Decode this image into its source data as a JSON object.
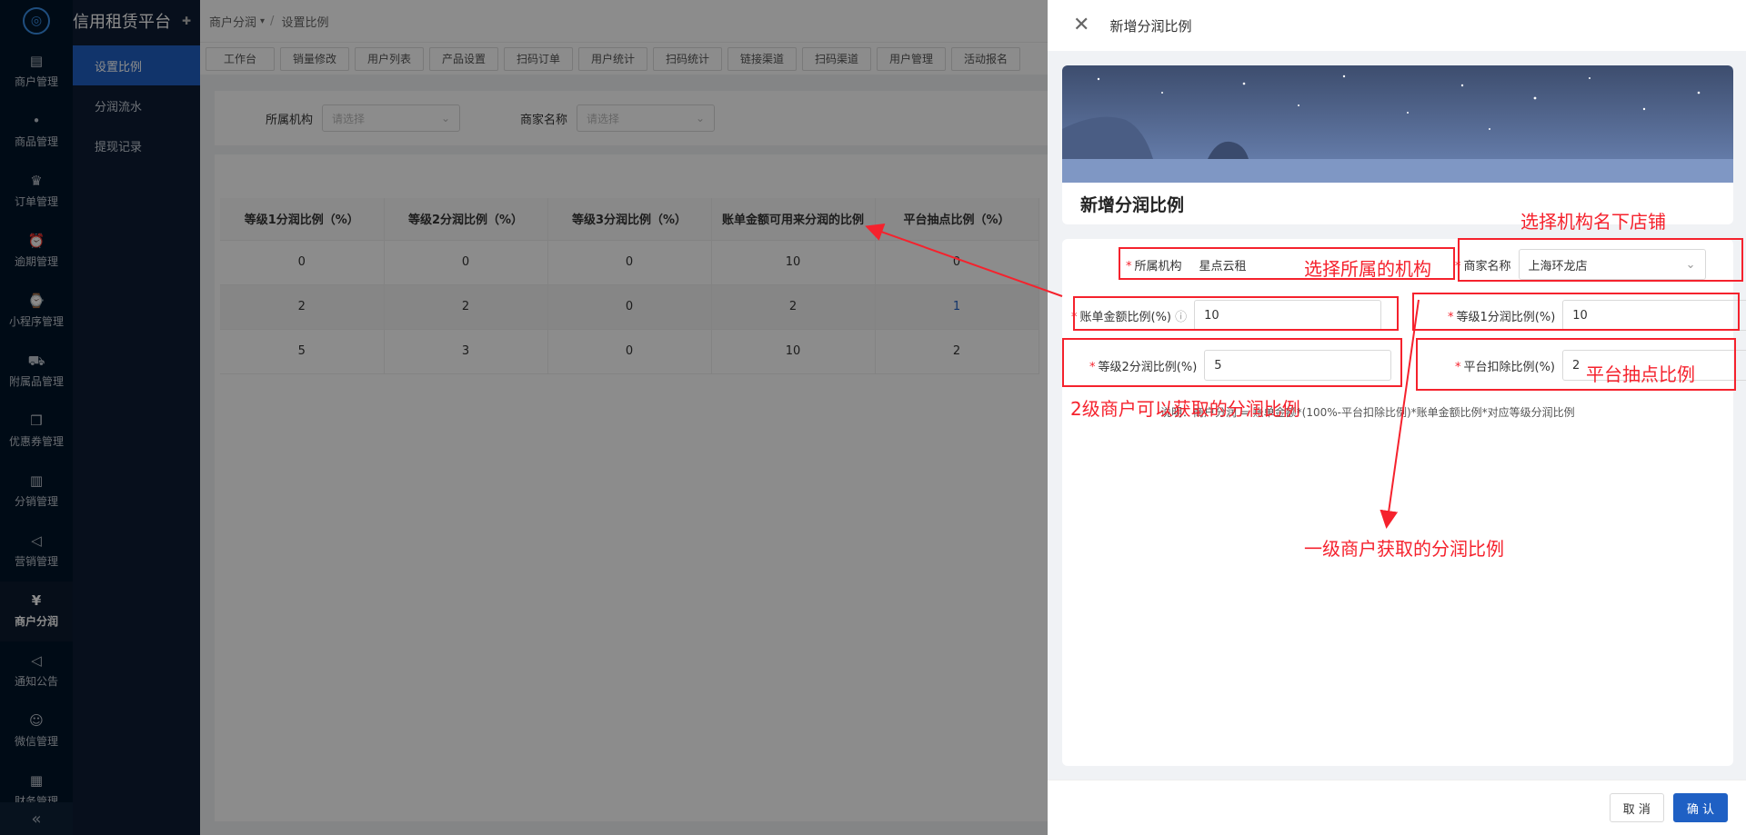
{
  "sidebar": {
    "brand": "信用租赁平台",
    "items": [
      {
        "label": "商户管理",
        "icon": "store-icon"
      },
      {
        "label": "商品管理",
        "icon": "apple-icon"
      },
      {
        "label": "订单管理",
        "icon": "trophy-icon"
      },
      {
        "label": "逾期管理",
        "icon": "alarm-icon"
      },
      {
        "label": "小程序管理",
        "icon": "watch-icon"
      },
      {
        "label": "附属品管理",
        "icon": "cart-icon"
      },
      {
        "label": "优惠券管理",
        "icon": "gift-icon"
      },
      {
        "label": "分销管理",
        "icon": "chart-icon"
      },
      {
        "label": "营销管理",
        "icon": "megaphone-icon"
      },
      {
        "label": "商户分润",
        "icon": "yen-icon",
        "active": true
      },
      {
        "label": "通知公告",
        "icon": "notice-icon"
      },
      {
        "label": "微信管理",
        "icon": "wechat-icon"
      },
      {
        "label": "财务管理",
        "icon": "finance-icon"
      }
    ],
    "collapse_glyph": "«"
  },
  "subnav": {
    "items": [
      {
        "label": "设置比例",
        "active": true
      },
      {
        "label": "分润流水"
      },
      {
        "label": "提现记录"
      }
    ]
  },
  "breadcrumb": {
    "parent": "商户分润",
    "separator": "/",
    "current": "设置比例"
  },
  "tabs": [
    "工作台",
    "销量修改",
    "用户列表",
    "产品设置",
    "扫码订单",
    "用户统计",
    "扫码统计",
    "链接渠道",
    "扫码渠道",
    "用户管理",
    "活动报名"
  ],
  "filter": {
    "org_label": "所属机构",
    "org_placeholder": "请选择",
    "merchant_label": "商家名称",
    "merchant_placeholder": "请选择"
  },
  "table": {
    "headers": [
      "等级1分润比例（%）",
      "等级2分润比例（%）",
      "等级3分润比例（%）",
      "账单金额可用来分润的比例",
      "平台抽点比例（%）"
    ],
    "rows": [
      [
        "0",
        "0",
        "0",
        "10",
        "0"
      ],
      [
        "2",
        "2",
        "0",
        "2",
        "1"
      ],
      [
        "5",
        "3",
        "0",
        "10",
        "2"
      ]
    ]
  },
  "drawer": {
    "header_title": "新增分润比例",
    "card_title": "新增分润比例",
    "fields": {
      "org_label": "所属机构",
      "org_value": "星点云租",
      "merchant_label": "商家名称",
      "merchant_value": "上海环龙店",
      "bill_ratio_label": "账单金额比例(%)",
      "bill_ratio_value": "10",
      "level1_label": "等级1分润比例(%)",
      "level1_value": "10",
      "level2_label": "等级2分润比例(%)",
      "level2_value": "5",
      "platform_label": "平台扣除比例(%)",
      "platform_value": "2"
    },
    "note": "说明：商户分润 = 账单金额*(100%-平台扣除比例)*账单金额比例*对应等级分润比例",
    "cancel_label": "取 消",
    "confirm_label": "确 认"
  },
  "annotations": {
    "org": "选择所属的机构",
    "merchant": "选择机构名下店铺",
    "platform": "平台抽点比例",
    "level2": "2级商户可以获取的分润比例",
    "level1": "一级商户获取的分润比例",
    "color": "#f5222d"
  }
}
